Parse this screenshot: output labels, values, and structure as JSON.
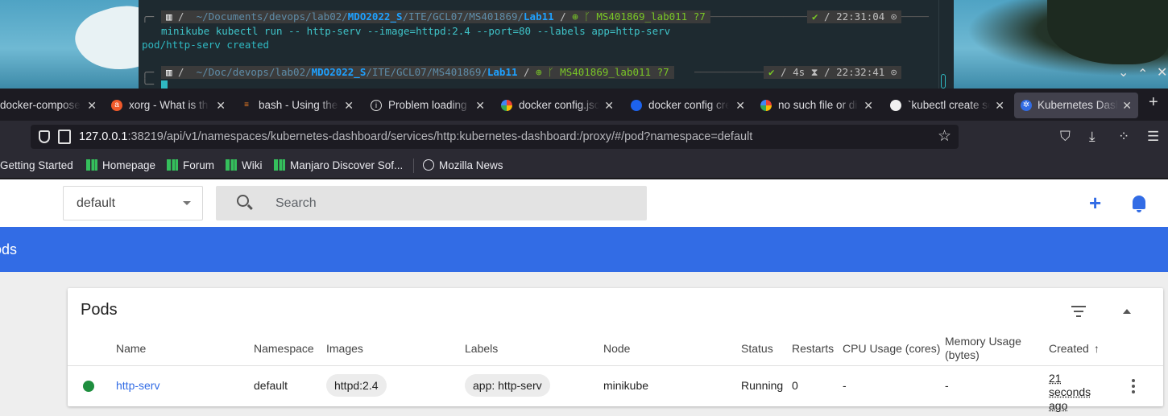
{
  "terminal": {
    "prompt1": {
      "path_prefix": " ~/Documents/devops/lab02/",
      "path_bold": "MDO2022_S",
      "path_mid": "/ITE/GCL07/MS401869/",
      "path_end": "Lab11",
      "branch": "MS401869_lab011 ?7",
      "status": "✔",
      "time": "22:31:04"
    },
    "command": "minikube kubectl run -- http-serv --image=httpd:2.4 --port=80 --labels app=http-serv",
    "output": "pod/http-serv created",
    "prompt2": {
      "path_prefix": " ~/Doc/devops/lab02/",
      "path_bold": "MDO2022_S",
      "path_mid": "/ITE/GCL07/MS401869/",
      "path_end": "Lab11",
      "branch": "MS401869_lab011 ?7",
      "status": "✔",
      "duration": "4s",
      "time": "22:32:41"
    }
  },
  "browser": {
    "tabs": [
      {
        "label": "docker-compose",
        "icon": "docker-icon"
      },
      {
        "label": "xorg - What is th",
        "icon": "askubuntu-icon"
      },
      {
        "label": "bash - Using the",
        "icon": "stackoverflow-icon"
      },
      {
        "label": "Problem loading",
        "icon": "info-icon"
      },
      {
        "label": "docker config.jso",
        "icon": "google-icon"
      },
      {
        "label": "docker config cre",
        "icon": "docker-icon"
      },
      {
        "label": "no such file or di",
        "icon": "google-icon"
      },
      {
        "label": "`kubectl create se",
        "icon": "github-icon"
      },
      {
        "label": "Kubernetes Dash",
        "icon": "kubernetes-icon"
      }
    ],
    "url_host": "127.0.0.1",
    "url_rest": ":38219/api/v1/namespaces/kubernetes-dashboard/services/http:kubernetes-dashboard:/proxy/#/pod?namespace=default",
    "bookmarks": [
      {
        "label": "Getting Started"
      },
      {
        "label": "Homepage"
      },
      {
        "label": "Forum"
      },
      {
        "label": "Wiki"
      },
      {
        "label": "Manjaro Discover Sof..."
      },
      {
        "label": "Mozilla News"
      }
    ]
  },
  "dashboard": {
    "namespace": "default",
    "search_placeholder": "Search",
    "section_title": "ods",
    "card_title": "Pods",
    "columns": [
      "Name",
      "Namespace",
      "Images",
      "Labels",
      "Node",
      "Status",
      "Restarts",
      "CPU Usage (cores)",
      "Memory Usage (bytes)",
      "Created"
    ],
    "sort_arrow": "↑",
    "rows": [
      {
        "name": "http-serv",
        "namespace": "default",
        "image": "httpd:2.4",
        "label": "app: http-serv",
        "node": "minikube",
        "status": "Running",
        "restarts": "0",
        "cpu": "-",
        "memory": "-",
        "created": "21 seconds ago",
        "status_color": "#1e8e3e"
      }
    ]
  },
  "colors": {
    "accent": "#326ce5",
    "terminal_bg": "#1e2a30",
    "running": "#1e8e3e"
  }
}
